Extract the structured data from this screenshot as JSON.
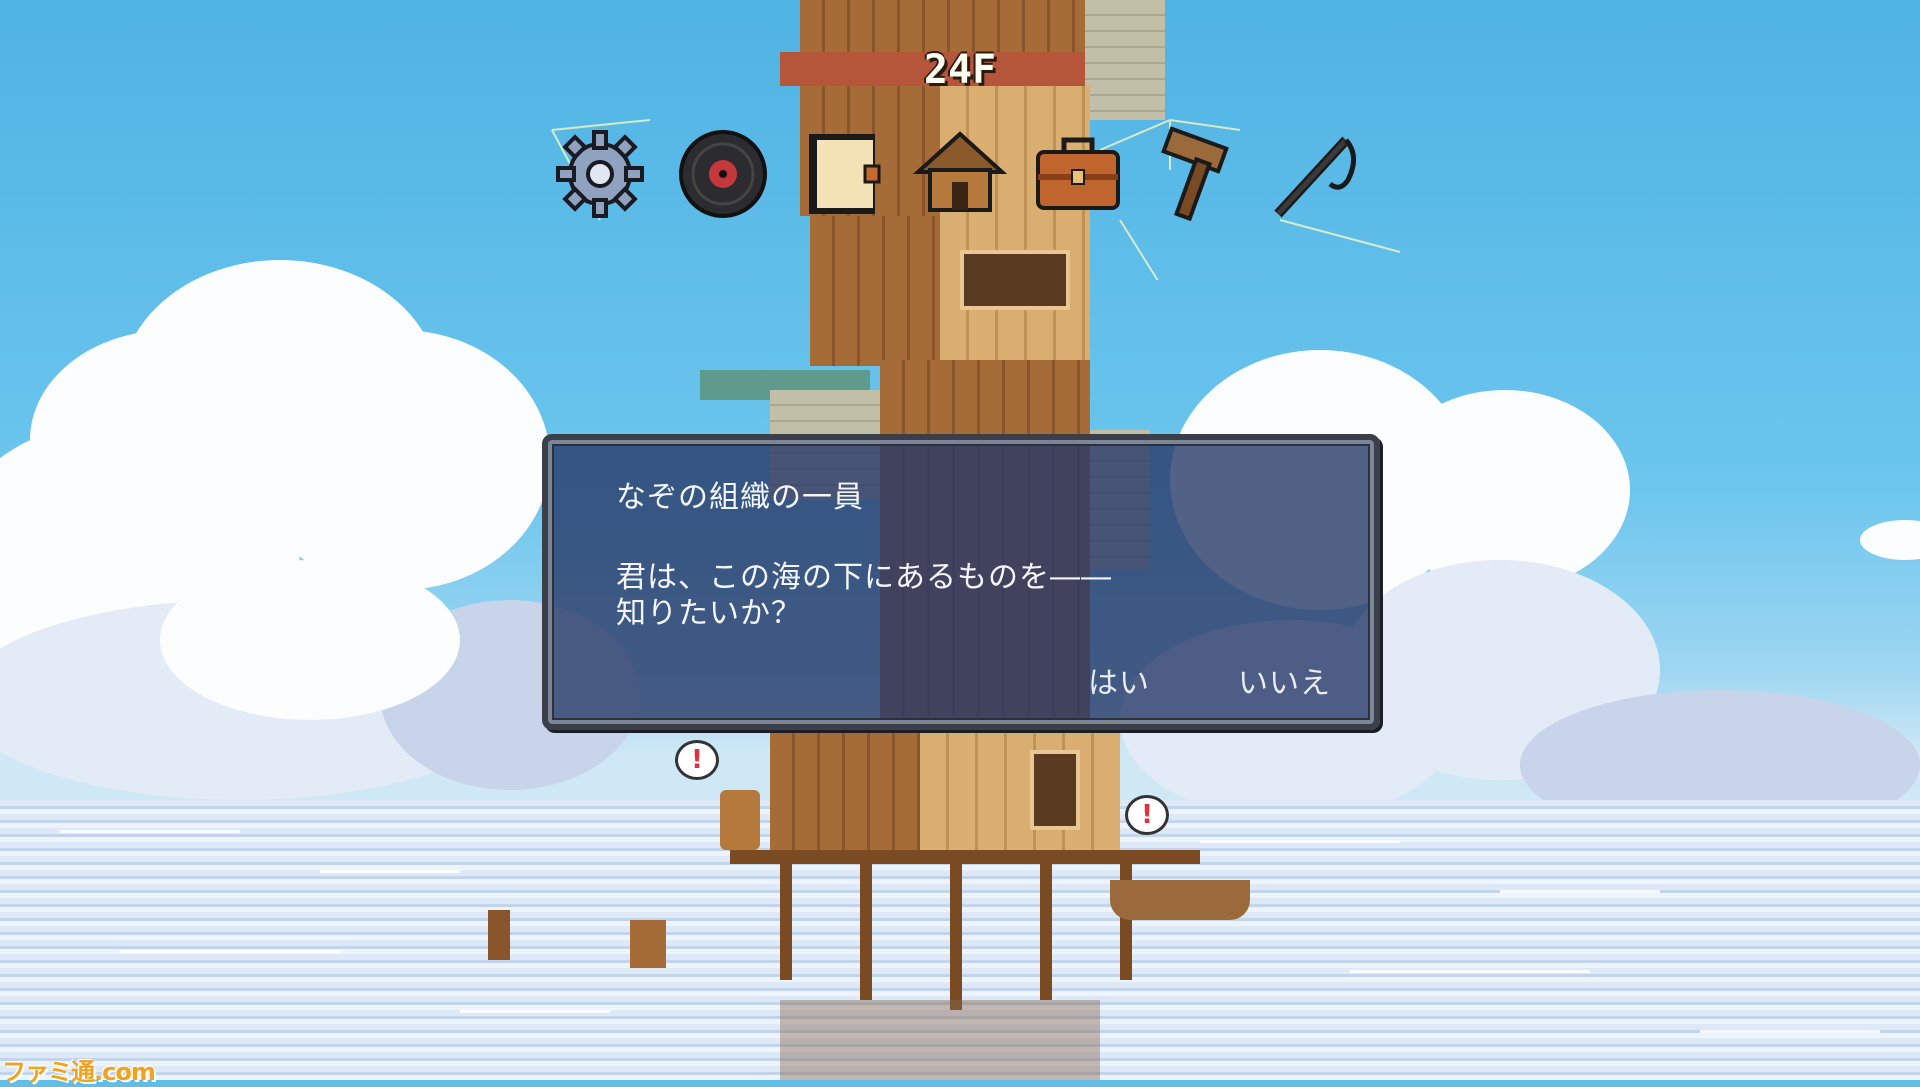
{
  "hud": {
    "floor_label": "24F",
    "toolbar": [
      {
        "name": "settings",
        "icon": "gear-icon"
      },
      {
        "name": "music",
        "icon": "record-disc-icon"
      },
      {
        "name": "journal",
        "icon": "book-icon"
      },
      {
        "name": "home",
        "icon": "house-icon"
      },
      {
        "name": "inventory",
        "icon": "briefcase-icon"
      },
      {
        "name": "build",
        "icon": "hammer-icon"
      },
      {
        "name": "fishing",
        "icon": "fishing-rod-icon"
      }
    ]
  },
  "dialog": {
    "speaker": "なぞの組織の一員",
    "line1": "君は、この海の下にあるものを――",
    "line2": "知りたいか？",
    "choices": {
      "yes": "はい",
      "no": "いいえ"
    }
  },
  "scene": {
    "alert_symbol": "!"
  },
  "watermark": "ファミ通.com",
  "colors": {
    "sky": "#5fbde6",
    "dialog_bg": "#283a68",
    "dialog_border": "#3a3f4a",
    "alert_red": "#e0323a"
  }
}
